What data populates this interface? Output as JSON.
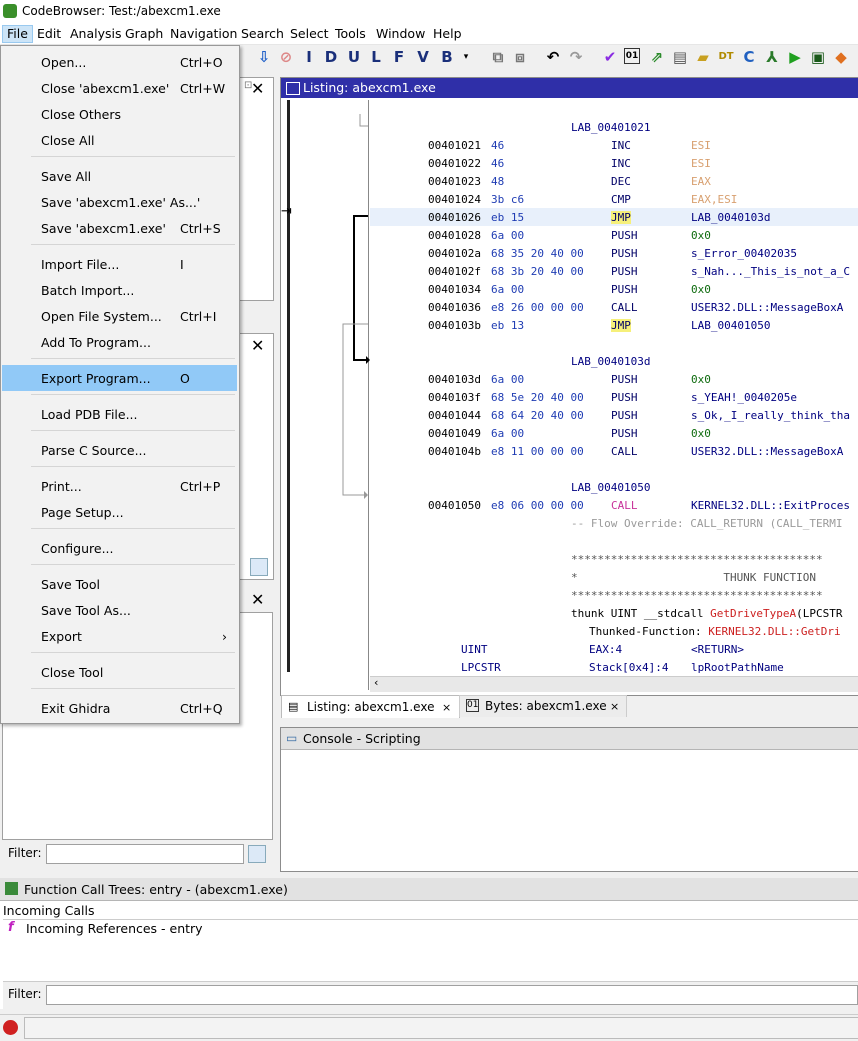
{
  "window": {
    "title": "CodeBrowser: Test:/abexcm1.exe"
  },
  "menubar": [
    "File",
    "Edit",
    "Analysis",
    "Graph",
    "Navigation",
    "Search",
    "Select",
    "Tools",
    "Window",
    "Help"
  ],
  "file_menu": [
    {
      "label": "Open...",
      "shortcut": "Ctrl+O"
    },
    {
      "label": "Close 'abexcm1.exe'",
      "shortcut": "Ctrl+W"
    },
    {
      "label": "Close Others",
      "shortcut": ""
    },
    {
      "label": "Close All",
      "shortcut": ""
    },
    {
      "label": "Save All",
      "shortcut": ""
    },
    {
      "label": "Save 'abexcm1.exe' As...'",
      "shortcut": ""
    },
    {
      "label": "Save 'abexcm1.exe'",
      "shortcut": "Ctrl+S"
    },
    {
      "label": "Import File...",
      "shortcut": "I"
    },
    {
      "label": "Batch Import...",
      "shortcut": ""
    },
    {
      "label": "Open File System...",
      "shortcut": "Ctrl+I"
    },
    {
      "label": "Add To Program...",
      "shortcut": ""
    },
    {
      "label": "Export Program...",
      "shortcut": "O"
    },
    {
      "label": "Load PDB File...",
      "shortcut": ""
    },
    {
      "label": "Parse C Source...",
      "shortcut": ""
    },
    {
      "label": "Print...",
      "shortcut": "Ctrl+P"
    },
    {
      "label": "Page Setup...",
      "shortcut": ""
    },
    {
      "label": "Configure...",
      "shortcut": ""
    },
    {
      "label": "Save Tool",
      "shortcut": ""
    },
    {
      "label": "Save Tool As...",
      "shortcut": ""
    },
    {
      "label": "Export",
      "shortcut": "›"
    },
    {
      "label": "Close Tool",
      "shortcut": ""
    },
    {
      "label": "Exit Ghidra",
      "shortcut": "Ctrl+Q"
    }
  ],
  "listing": {
    "header": "Listing:  abexcm1.exe",
    "lines": [
      {
        "label": "LAB_00401021"
      },
      {
        "addr": "00401021",
        "bytes": "46",
        "mnem": "INC",
        "op": "ESI"
      },
      {
        "addr": "00401022",
        "bytes": "46",
        "mnem": "INC",
        "op": "ESI"
      },
      {
        "addr": "00401023",
        "bytes": "48",
        "mnem": "DEC",
        "op": "EAX"
      },
      {
        "addr": "00401024",
        "bytes": "3b c6",
        "mnem": "CMP",
        "op": "EAX,ESI"
      },
      {
        "addr": "00401026",
        "bytes": "eb 15",
        "mnem": "JMP",
        "op": "LAB_0040103d"
      },
      {
        "addr": "00401028",
        "bytes": "6a 00",
        "mnem": "PUSH",
        "op": "0x0"
      },
      {
        "addr": "0040102a",
        "bytes": "68 35 20 40 00",
        "mnem": "PUSH",
        "op": "s_Error_00402035"
      },
      {
        "addr": "0040102f",
        "bytes": "68 3b 20 40 00",
        "mnem": "PUSH",
        "op": "s_Nah..._This_is_not_a_C"
      },
      {
        "addr": "00401034",
        "bytes": "6a 00",
        "mnem": "PUSH",
        "op": "0x0"
      },
      {
        "addr": "00401036",
        "bytes": "e8 26 00 00 00",
        "mnem": "CALL",
        "op": "USER32.DLL::MessageBoxA"
      },
      {
        "addr": "0040103b",
        "bytes": "eb 13",
        "mnem": "JMP",
        "op": "LAB_00401050"
      },
      {
        "label": "LAB_0040103d"
      },
      {
        "addr": "0040103d",
        "bytes": "6a 00",
        "mnem": "PUSH",
        "op": "0x0"
      },
      {
        "addr": "0040103f",
        "bytes": "68 5e 20 40 00",
        "mnem": "PUSH",
        "op": "s_YEAH!_0040205e"
      },
      {
        "addr": "00401044",
        "bytes": "68 64 20 40 00",
        "mnem": "PUSH",
        "op": "s_Ok,_I_really_think_tha"
      },
      {
        "addr": "00401049",
        "bytes": "6a 00",
        "mnem": "PUSH",
        "op": "0x0"
      },
      {
        "addr": "0040104b",
        "bytes": "e8 11 00 00 00",
        "mnem": "CALL",
        "op": "USER32.DLL::MessageBoxA"
      },
      {
        "label": "LAB_00401050"
      },
      {
        "addr": "00401050",
        "bytes": "e8 06 00 00 00",
        "mnem": "CALL",
        "op": "KERNEL32.DLL::ExitProces"
      }
    ],
    "flow_override": "-- Flow Override: CALL_RETURN (CALL_TERMI",
    "stars": "**************************************",
    "thunk_title": "*                      THUNK FUNCTION",
    "thunk_sig_prefix": "thunk UINT __stdcall ",
    "thunk_sig_fn": "GetDriveTypeA",
    "thunk_sig_suffix": "(LPCSTR",
    "thunked_prefix": "Thunked-Function: ",
    "thunked_fn": "KERNEL32.DLL::GetDri",
    "param1": {
      "type": "UINT",
      "loc": "EAX:4",
      "name": "<RETURN>"
    },
    "param2": {
      "type": "LPCSTR",
      "loc": "Stack[0x4]:4",
      "name": "lpRootPathName"
    }
  },
  "tabs": [
    {
      "label": "Listing:  abexcm1.exe"
    },
    {
      "label": "Bytes: abexcm1.exe"
    }
  ],
  "console": {
    "title": "Console - Scripting"
  },
  "filters": {
    "label": "Filter:"
  },
  "function_call_trees": {
    "title": "Function Call Trees: entry -  (abexcm1.exe)",
    "incoming_label": "Incoming Calls",
    "node": "Incoming References - entry"
  }
}
